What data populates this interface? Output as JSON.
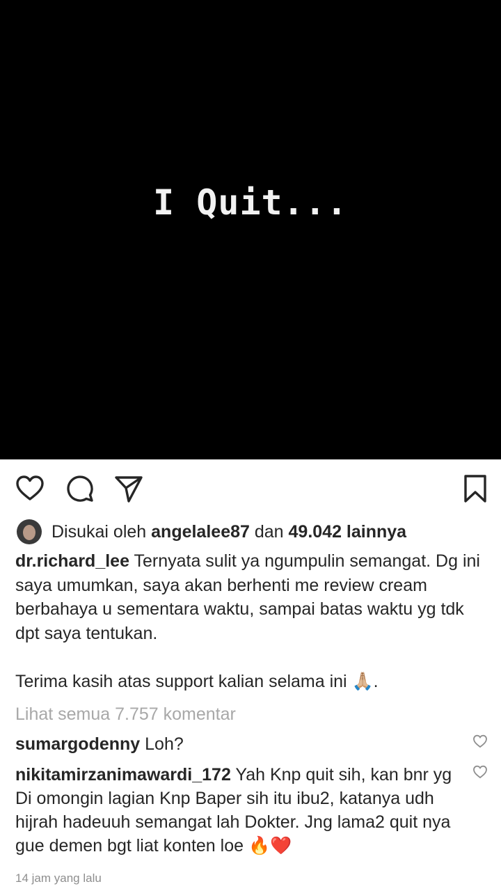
{
  "post": {
    "image_text": "I Quit..."
  },
  "actions": {
    "like_icon": "heart-outline-icon",
    "comment_icon": "speech-bubble-icon",
    "share_icon": "paper-plane-icon",
    "save_icon": "bookmark-icon"
  },
  "likes": {
    "prefix": "Disukai oleh ",
    "user": "angelalee87",
    "middle": " dan ",
    "count": "49.042 lainnya"
  },
  "caption": {
    "user": "dr.richard_lee",
    "text": " Ternyata sulit ya ngumpulin semangat. Dg ini saya umumkan, saya akan berhenti me review cream berbahaya u sementara waktu, sampai batas waktu yg tdk dpt saya tentukan.\n\nTerima kasih atas support kalian selama ini 🙏🏼."
  },
  "view_all_comments": "Lihat semua 7.757 komentar",
  "comments": [
    {
      "user": "sumargodenny",
      "text": " Loh?"
    },
    {
      "user": "nikitamirzanimawardi_172",
      "text": " Yah Knp quit sih, kan bnr yg Di omongin lagian Knp Baper sih itu ibu2, katanya udh hijrah hadeuuh semangat lah Dokter. Jng lama2 quit nya gue demen bgt liat konten loe 🔥❤️"
    }
  ],
  "timestamp": "14 jam yang lalu",
  "colors": {
    "text": "#262626",
    "muted": "#a8a8a8",
    "image_bg": "#000000"
  }
}
